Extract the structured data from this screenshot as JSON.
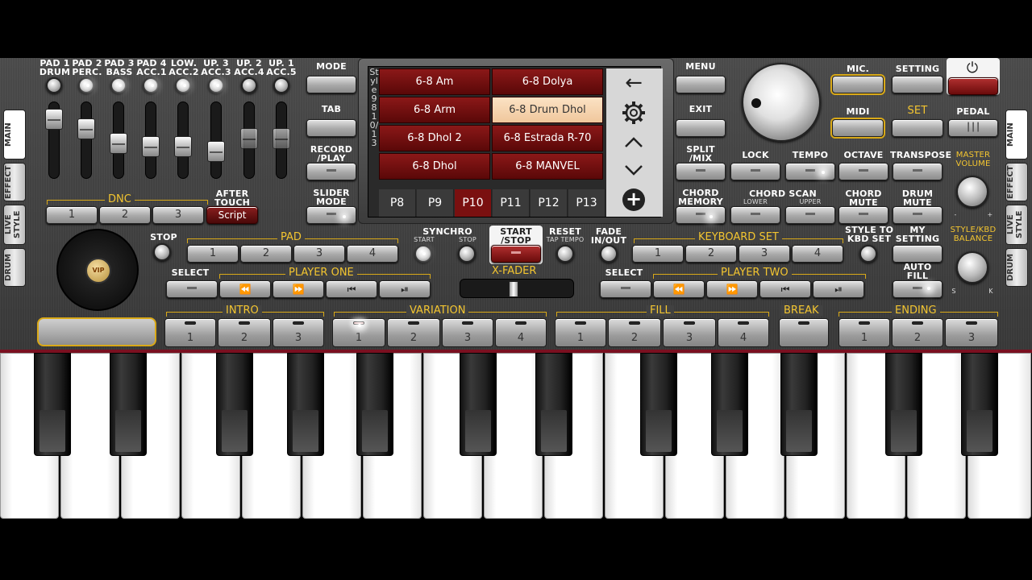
{
  "pads": {
    "labels": [
      "PAD 1\nDRUM",
      "PAD 2\nPERC.",
      "PAD 3\nBASS",
      "PAD 4\nACC.1",
      "LOW.\nACC.2",
      "UP. 3\nACC.3",
      "UP. 2\nACC.4",
      "UP. 1\nACC.5"
    ]
  },
  "side_tabs_left": [
    "MAIN",
    "EFFECT",
    "LIVE STYLE",
    "DRUM"
  ],
  "side_tabs_right": [
    "MAIN",
    "EFFECT",
    "LIVE STYLE",
    "DRUM"
  ],
  "dnc": {
    "title": "DNC",
    "after_touch": "AFTER\nTOUCH",
    "buttons": [
      "1",
      "2",
      "3"
    ],
    "script": "Script"
  },
  "left_col": {
    "mode": "MODE",
    "tab": "TAB",
    "record": "RECORD\n/PLAY",
    "slider": "SLIDER\nMODE"
  },
  "right_col": {
    "menu": "MENU",
    "exit": "EXIT",
    "split": "SPLIT\n/MIX",
    "chord_memory": "CHORD\nMEMORY"
  },
  "styles": {
    "side_label": "Style 98 10/13",
    "cells": [
      "6-8 Am",
      "6-8 Dolya",
      "6-8 Arm",
      "6-8 Drum Dhol",
      "6-8 Dhol 2",
      "6-8 Estrada R-70",
      "6-8 Dhol",
      "6-8 MANVEL"
    ],
    "selected": 3,
    "pages": [
      "P8",
      "P9",
      "P10",
      "P11",
      "P12",
      "P13"
    ],
    "selected_page": 2
  },
  "top_right": {
    "mic": "MIC.",
    "setting": "SETTING",
    "midi": "MIDI",
    "set": "SET",
    "pedal": "PEDAL"
  },
  "knob_labels": {
    "lock": "LOCK",
    "tempo": "TEMPO",
    "octave": "OCTAVE",
    "transpose": "TRANSPOSE",
    "master_volume": "MASTER\nVOLUME",
    "chord_scan": "CHORD SCAN",
    "lower": "LOWER",
    "upper": "UPPER",
    "chord_mute": "CHORD\nMUTE",
    "drum_mute": "DRUM\nMUTE",
    "style_kbd": "STYLE/KBD\nBALANCE",
    "s": "S",
    "k": "K",
    "minus": "-",
    "plus": "+"
  },
  "middle": {
    "stop": "STOP",
    "pad": "PAD",
    "pad_buttons": [
      "1",
      "2",
      "3",
      "4"
    ],
    "synchro": "SYNCHRO",
    "start": "START",
    "stop2": "STOP",
    "start_stop": "START\n/STOP",
    "reset": "RESET",
    "tap_tempo": "TAP TEMPO",
    "fade": "FADE\nIN/OUT",
    "keyboard_set": "KEYBOARD SET",
    "kbd_buttons": [
      "1",
      "2",
      "3",
      "4"
    ],
    "style_to_kbd": "STYLE TO\nKBD SET",
    "my_setting": "MY\nSETTING",
    "auto_fill": "AUTO\nFILL",
    "x_fader": "X-FADER"
  },
  "players": {
    "select": "SELECT",
    "player_one": "PLAYER ONE",
    "select2": "SELECT",
    "player_two": "PLAYER TWO"
  },
  "vip": "VIP",
  "sections": {
    "intro": {
      "title": "INTRO",
      "buttons": [
        "1",
        "2",
        "3"
      ]
    },
    "variation": {
      "title": "VARIATION",
      "buttons": [
        "1",
        "2",
        "3",
        "4"
      ]
    },
    "fill": {
      "title": "FILL",
      "buttons": [
        "1",
        "2",
        "3",
        "4"
      ]
    },
    "break": {
      "title": "BREAK"
    },
    "ending": {
      "title": "ENDING",
      "buttons": [
        "1",
        "2",
        "3"
      ]
    }
  },
  "colors": {
    "accent": "#f3c530",
    "style_cell": "#7a1010",
    "selected_cell": "#f5d2ab"
  }
}
